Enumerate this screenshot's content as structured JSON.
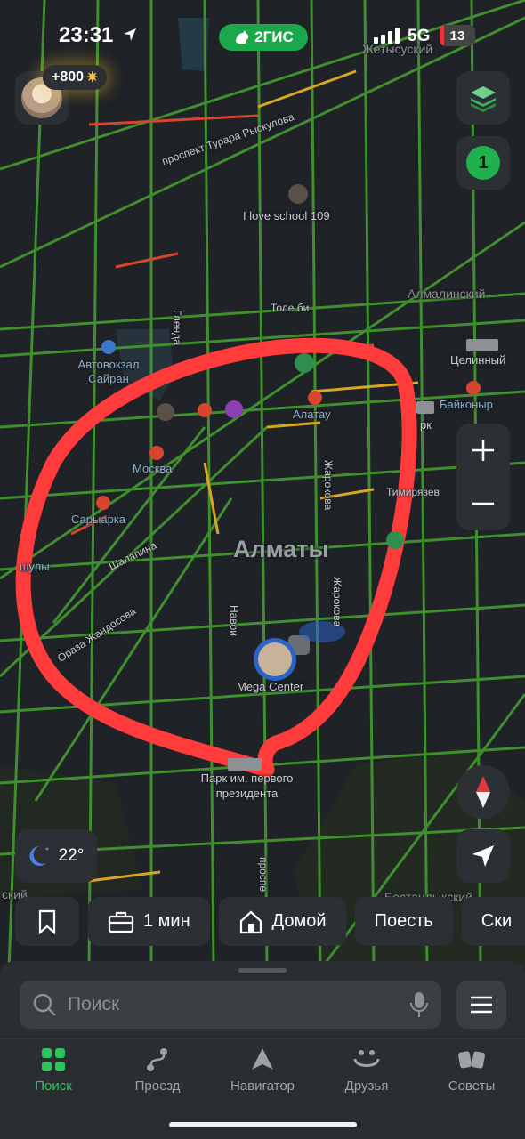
{
  "status_bar": {
    "time": "23:31",
    "app_badge": "2ГИС",
    "network": "5G",
    "battery": "13",
    "battery_level_percent": 13,
    "signal_bars": 4
  },
  "profile": {
    "points": "+800"
  },
  "map": {
    "city": "Алматы",
    "districts": [
      "Жетысуский",
      "Алмалинский"
    ],
    "streets": [
      "проспект Турара Рыскулова",
      "Толе би",
      "Гленда",
      "Шалапина",
      "Оразa Жандосова",
      "Навои",
      "Жарокова",
      "Жарокова",
      "Тимирязев",
      "проспе"
    ],
    "metro": [
      "Москва",
      "Сарыарка",
      "Алатау",
      "Байконыр",
      "шулы"
    ],
    "places": [
      "I love school 109",
      "Автовокзал Сайран",
      "Целинный",
      "Mega Center",
      "Парк им. первого президента",
      "рк"
    ],
    "bottom_fragments": [
      "ский",
      "Бостандыкский"
    ],
    "route_counter": "1",
    "colors": {
      "road_free": "#3f8f2e",
      "road_slow": "#d9a623",
      "road_jam": "#d8452f",
      "annotation": "#ff3b3b",
      "accent": "#1fb14b"
    }
  },
  "weather": {
    "icon": "moon-icon",
    "temperature": "22°"
  },
  "quick_chips": [
    {
      "icon": "bookmark-icon",
      "label": ""
    },
    {
      "icon": "briefcase-icon",
      "label": "1 мин"
    },
    {
      "icon": "home-icon",
      "label": "Домой"
    },
    {
      "icon": "",
      "label": "Поесть"
    },
    {
      "icon": "",
      "label": "Ски"
    }
  ],
  "search": {
    "placeholder": "Поиск"
  },
  "tabs": [
    {
      "label": "Поиск",
      "icon": "search-grid-icon",
      "active": true
    },
    {
      "label": "Проезд",
      "icon": "route-icon",
      "active": false
    },
    {
      "label": "Навигатор",
      "icon": "navigator-icon",
      "active": false
    },
    {
      "label": "Друзья",
      "icon": "friends-icon",
      "active": false
    },
    {
      "label": "Советы",
      "icon": "tips-icon",
      "active": false
    }
  ]
}
